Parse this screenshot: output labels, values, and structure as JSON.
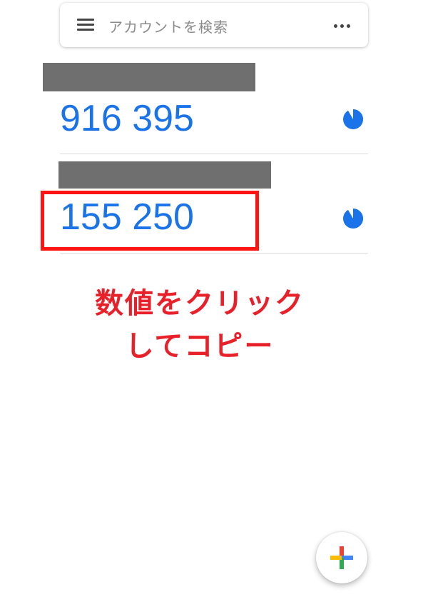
{
  "search": {
    "placeholder": "アカウントを検索",
    "menu_icon": "hamburger-menu-icon",
    "more_icon": "more-horizontal-icon"
  },
  "accounts": [
    {
      "code": "916 395",
      "timer_icon": "countdown-pie-icon",
      "timer_remaining": 0.85
    },
    {
      "code": "155 250",
      "timer_icon": "countdown-pie-icon",
      "timer_remaining": 0.85
    }
  ],
  "annotation": {
    "line1": "数値をクリック",
    "line2": "してコピー",
    "color": "#e8202a"
  },
  "fab": {
    "icon": "add-plus-icon",
    "colors": [
      "#ea4335",
      "#4285f4",
      "#34a853",
      "#fbbc05"
    ]
  },
  "colors": {
    "code_blue": "#1a73e8",
    "highlight_red": "#ff1414"
  }
}
